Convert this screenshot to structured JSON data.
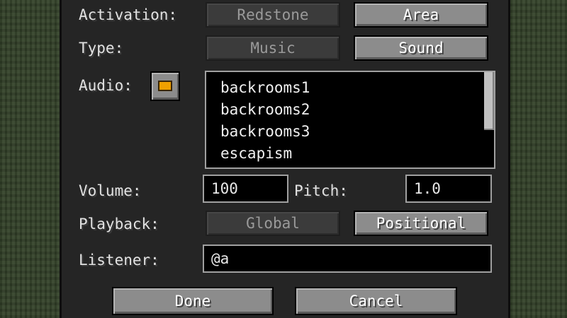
{
  "activation": {
    "label": "Activation:",
    "options": [
      "Redstone",
      "Area"
    ],
    "selected": "Area"
  },
  "type": {
    "label": "Type:",
    "options": [
      "Music",
      "Sound"
    ],
    "selected": "Sound"
  },
  "audio": {
    "label": "Audio:",
    "swatch_color": "#f0a000",
    "items": [
      "backrooms1",
      "backrooms2",
      "backrooms3",
      "escapism"
    ]
  },
  "volume": {
    "label": "Volume:",
    "value": "100"
  },
  "pitch": {
    "label": "Pitch:",
    "value": "1.0"
  },
  "playback": {
    "label": "Playback:",
    "options": [
      "Global",
      "Positional"
    ],
    "selected": "Positional"
  },
  "listener": {
    "label": "Listener:",
    "value": "@a"
  },
  "actions": {
    "done_label": "Done",
    "cancel_label": "Cancel"
  }
}
